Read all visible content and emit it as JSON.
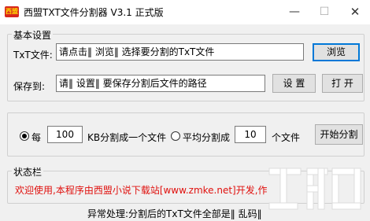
{
  "window": {
    "icon_text": "西盟",
    "title": "西盟TXT文件分割器 V3.1 正式版",
    "minimize_glyph": "—",
    "maximize_glyph": "☐",
    "close_glyph": "✕"
  },
  "basic_settings": {
    "legend": "基本设置",
    "txt_label": "TxT文件:",
    "txt_value": "请点击‖ 浏览‖ 选择要分割的TxT文件",
    "browse_label": "浏览",
    "save_label": "保存到:",
    "save_value": "请‖ 设置‖ 要保存分割后文件的路径",
    "set_label": "设 置",
    "open_label": "打 开"
  },
  "split_options": {
    "per_label": "每",
    "per_kb_value": "100",
    "per_kb_suffix": "KB分割成一个文件",
    "even_label": "平均分割成",
    "even_count_value": "10",
    "even_suffix": "个文件",
    "start_label": "开始分割",
    "selected_mode": "per_kb"
  },
  "status": {
    "legend": "状态栏",
    "message": "欢迎使用,本程序由西盟小说下载站[www.zmke.net]开发,作者",
    "footer_note": "异常处理:分割后的TxT文件全部是‖ 乱码‖"
  },
  "colors": {
    "status_text": "#e0110e",
    "focus_border": "#0078d7",
    "icon_bg": "#d8261c"
  }
}
